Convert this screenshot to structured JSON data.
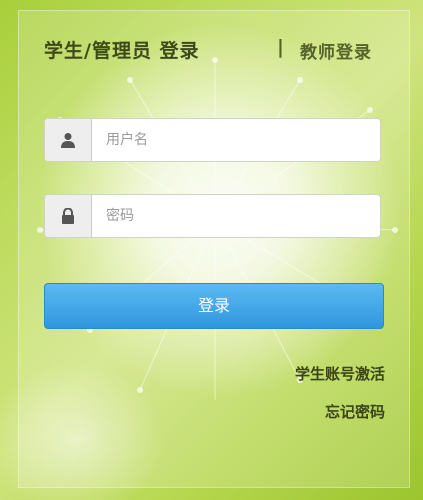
{
  "tabs": {
    "active_label": "学生/管理员 登录",
    "separator": "|",
    "teacher_label": "教师登录"
  },
  "form": {
    "username": {
      "icon": "user-icon",
      "placeholder": "用户名",
      "value": ""
    },
    "password": {
      "icon": "lock-icon",
      "placeholder": "密码",
      "value": ""
    },
    "submit_label": "登录"
  },
  "links": {
    "activate_account": "学生账号激活",
    "forgot_password": "忘记密码"
  },
  "colors": {
    "primary_button": "#2f96dd",
    "background_green": "#b5d64c"
  }
}
